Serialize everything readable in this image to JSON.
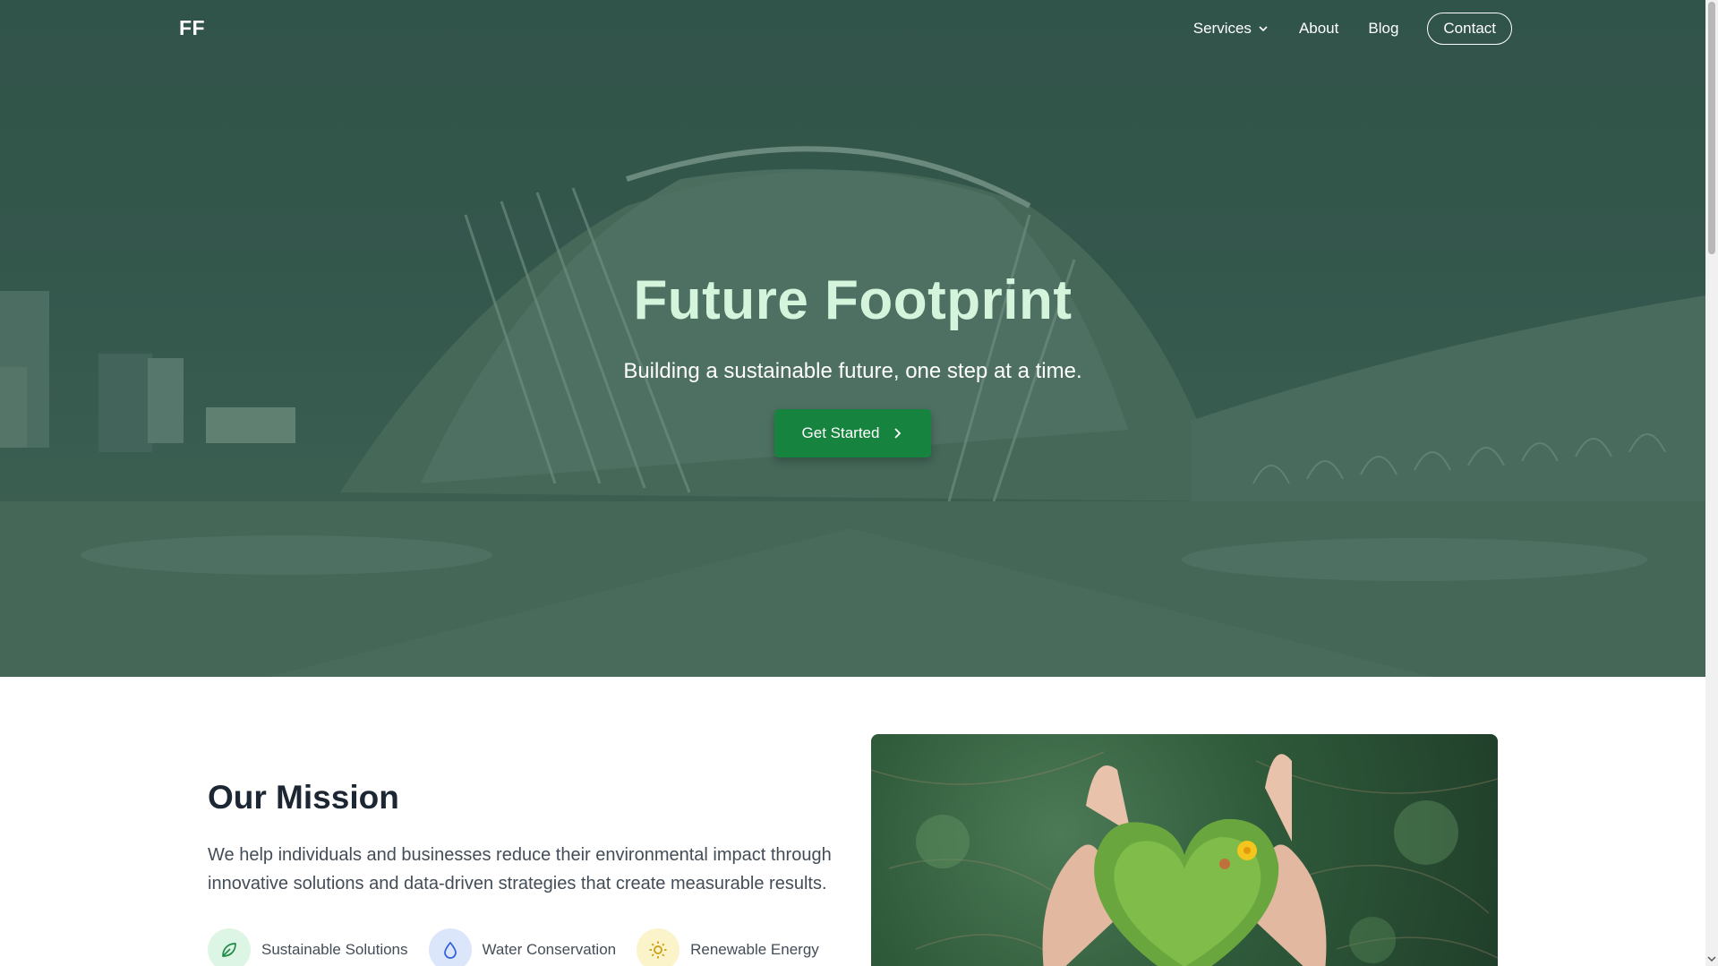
{
  "nav": {
    "logo": "FF",
    "links": [
      {
        "label": "Services",
        "icon": "chevron-down-icon"
      },
      {
        "label": "About"
      },
      {
        "label": "Blog"
      }
    ],
    "contact_label": "Contact"
  },
  "hero": {
    "title": "Future Footprint",
    "subtitle": "Building a sustainable future, one step at a time.",
    "cta_label": "Get Started",
    "cta_icon": "chevron-right-icon"
  },
  "mission": {
    "title": "Our Mission",
    "description": "We help individuals and businesses reduce their environmental impact through innovative solutions and data-driven strategies that create measurable results.",
    "features": [
      {
        "label": "Sustainable Solutions",
        "icon": "leaf-icon",
        "bg": "#dcf5e4",
        "color": "#1e8a46"
      },
      {
        "label": "Water Conservation",
        "icon": "water-drop-icon",
        "bg": "#dbe6fb",
        "color": "#2e5ed8"
      },
      {
        "label": "Renewable Energy",
        "icon": "sun-icon",
        "bg": "#fbf3c9",
        "color": "#c99a0a"
      }
    ]
  },
  "colors": {
    "accent_green": "#16833f",
    "hero_title": "#d4f5dc",
    "heading_dark": "#1c2733"
  }
}
